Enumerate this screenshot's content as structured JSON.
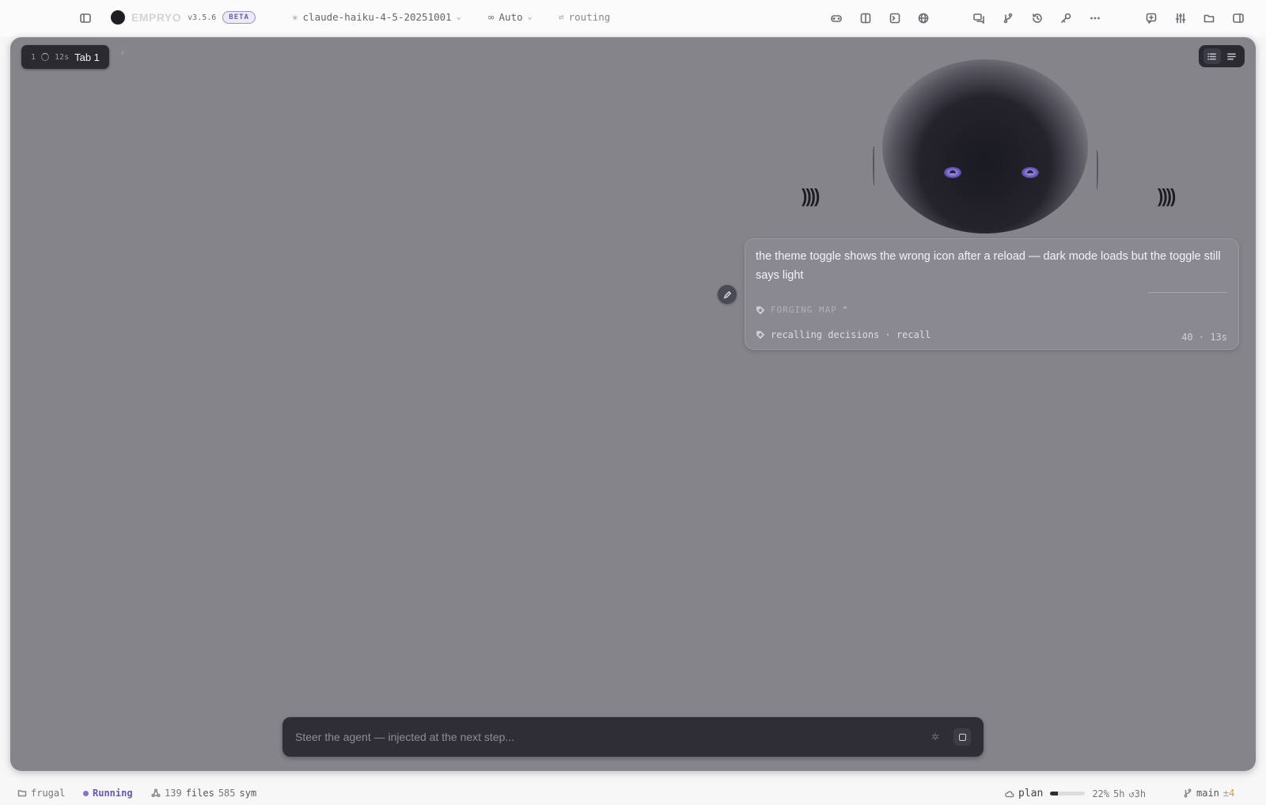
{
  "app": {
    "brand": "EMPRYO",
    "version": "v3.5.6",
    "beta": "BETA"
  },
  "toolbar": {
    "model": "claude-haiku-4-5-20251001",
    "mode": "Auto",
    "routing": "routing"
  },
  "tab": {
    "number": "1",
    "elapsed": "12s",
    "label": "Tab 1",
    "add": "+"
  },
  "message": {
    "text": "the theme toggle shows the wrong icon after a reload — dark mode loads but the toggle still says light",
    "section_label": "FORGING MAP",
    "activity": "recalling decisions · recall",
    "meta": "40 · 13s"
  },
  "steer": {
    "placeholder": "Steer the agent — injected at the next step..."
  },
  "status": {
    "profile": "frugal",
    "state": "Running",
    "files_count": "139",
    "files_label": "files",
    "sym_count": "585",
    "sym_label": "sym",
    "plan_label": "plan",
    "plan_usage": 0.22,
    "plan_percent": "22%",
    "plan_window": "5h",
    "plan_reset": "↺3h",
    "branch": "main",
    "branch_delta": "±4"
  },
  "colors": {
    "accent": "#8a6fd0",
    "panel": "#85848a",
    "eye": "#b9a8ff"
  }
}
